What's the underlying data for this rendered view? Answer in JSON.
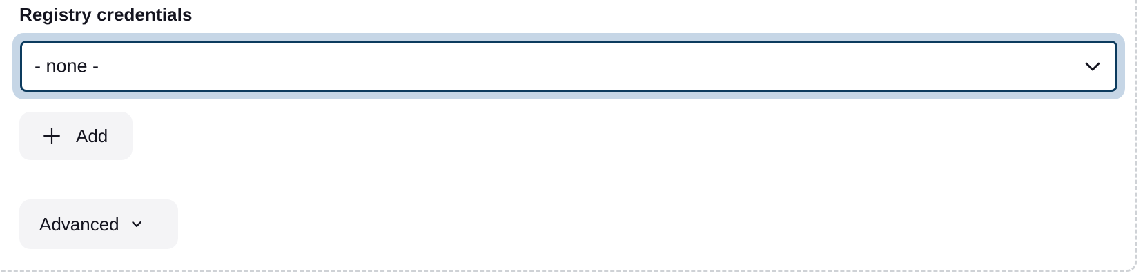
{
  "registry_credentials": {
    "label": "Registry credentials",
    "select": {
      "value": "- none -"
    }
  },
  "buttons": {
    "add_label": "Add",
    "advanced_label": "Advanced"
  },
  "icons": {
    "add": "plus-icon",
    "select_dropdown": "chevron-down-icon",
    "advanced_toggle": "chevron-down-icon"
  },
  "colors": {
    "focus_ring": "#c6d6e6",
    "select_border": "#0c3b5e",
    "button_background": "#f4f4f6",
    "panel_dashed_border": "#cfd2d6",
    "text": "#14141f"
  }
}
